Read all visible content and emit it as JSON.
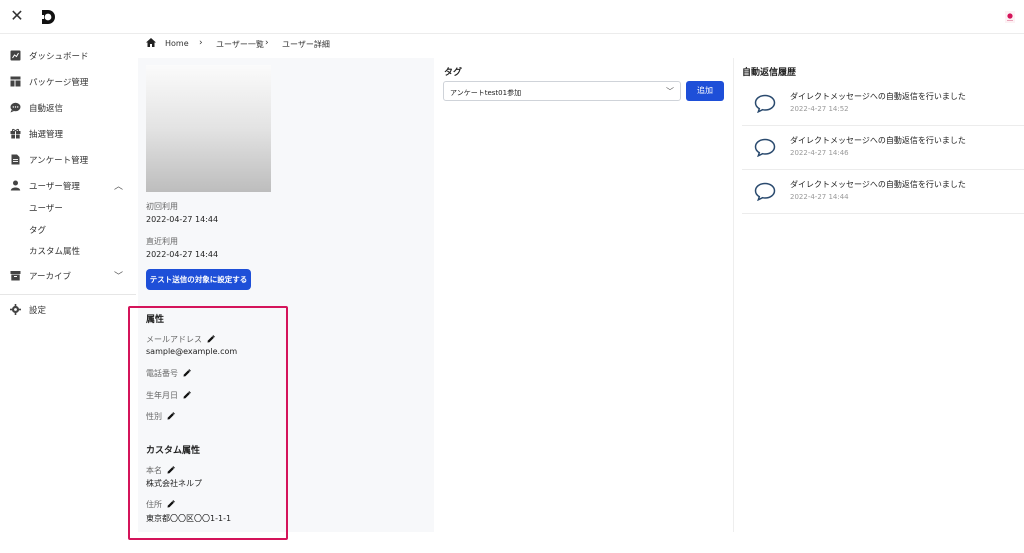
{
  "sidebar": {
    "items": [
      {
        "label": "ダッシュボード",
        "icon": "dashboard-icon"
      },
      {
        "label": "パッケージ管理",
        "icon": "package-icon"
      },
      {
        "label": "自動返信",
        "icon": "chat-icon"
      },
      {
        "label": "抽選管理",
        "icon": "gift-icon"
      },
      {
        "label": "アンケート管理",
        "icon": "survey-icon"
      },
      {
        "label": "ユーザー管理",
        "icon": "user-icon"
      },
      {
        "label": "アーカイブ",
        "icon": "archive-icon"
      },
      {
        "label": "設定",
        "icon": "gear-icon"
      }
    ],
    "user_sub": [
      "ユーザー",
      "タグ",
      "カスタム属性"
    ]
  },
  "breadcrumb": [
    "Home",
    "ユーザー一覧",
    "ユーザー詳細"
  ],
  "profile": {
    "first_use_label": "初回利用",
    "first_use_value": "2022-04-27 14:44",
    "last_use_label": "直近利用",
    "last_use_value": "2022-04-27 14:44",
    "test_button": "テスト送信の対象に設定する"
  },
  "attributes": {
    "title": "属性",
    "email_label": "メールアドレス",
    "email_value": "sample@example.com",
    "phone_label": "電話番号",
    "birthday_label": "生年月日",
    "gender_label": "性別"
  },
  "custom_attributes": {
    "title": "カスタム属性",
    "name_label": "本名",
    "name_value": "株式会社ネルプ",
    "address_label": "住所",
    "address_value": "東京都〇〇区〇〇1-1-1"
  },
  "tag": {
    "title": "タグ",
    "selected": "アンケートtest01参加",
    "add_button": "追加"
  },
  "history": {
    "title": "自動返信履歴",
    "items": [
      {
        "message": "ダイレクトメッセージへの自動返信を行いました",
        "time": "2022-4-27 14:52"
      },
      {
        "message": "ダイレクトメッセージへの自動返信を行いました",
        "time": "2022-4-27 14:46"
      },
      {
        "message": "ダイレクトメッセージへの自動返信を行いました",
        "time": "2022-4-27 14:44"
      }
    ]
  },
  "colors": {
    "accent": "#1e4fd8",
    "highlight": "#d4145a"
  }
}
